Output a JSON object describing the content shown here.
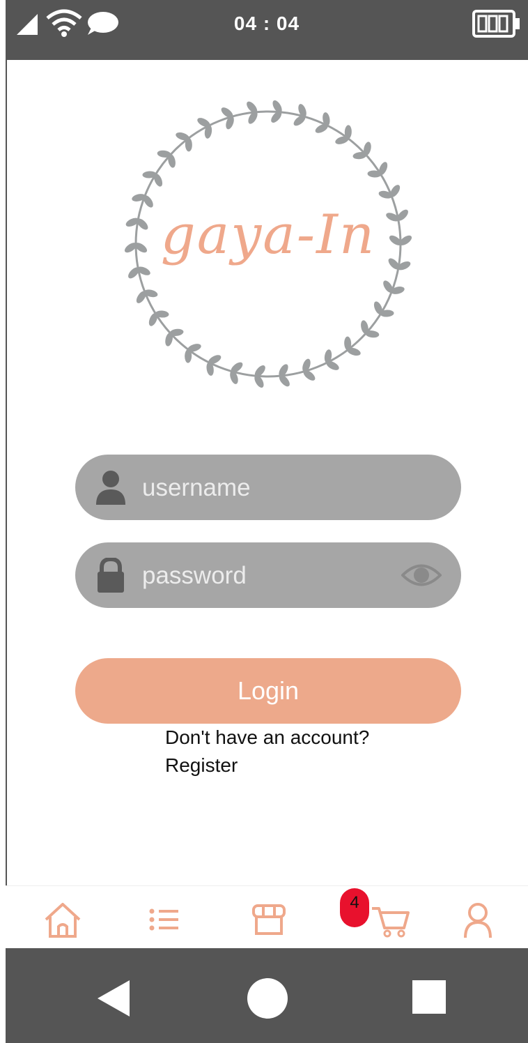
{
  "status_bar": {
    "time": "04 : 04",
    "icons": [
      "signal-icon",
      "wifi-icon",
      "chat-bubble-icon",
      "battery-icon"
    ]
  },
  "logo": {
    "text": "gaya-In",
    "wreath_color": "#9c9fa0",
    "text_color": "#EFA88B"
  },
  "login_form": {
    "username_placeholder": "username",
    "password_placeholder": "password",
    "login_label": "Login",
    "account_prompt": "Don't have an account?",
    "register_label": "Register"
  },
  "tab_bar": {
    "items": [
      {
        "name": "home",
        "icon": "home-icon"
      },
      {
        "name": "list",
        "icon": "list-icon"
      },
      {
        "name": "store",
        "icon": "store-icon"
      },
      {
        "name": "cart",
        "icon": "cart-icon"
      },
      {
        "name": "profile",
        "icon": "user-icon"
      }
    ],
    "cart_badge": "4",
    "accent": "#EFA88B"
  },
  "nav_bar": {
    "icons": [
      "back-icon",
      "home-circle-icon",
      "recents-icon"
    ]
  },
  "colors": {
    "field_bg": "#a6a6a6",
    "button_bg": "#EDA98B",
    "badge_bg": "#E8112D",
    "system_bar": "#555555"
  }
}
